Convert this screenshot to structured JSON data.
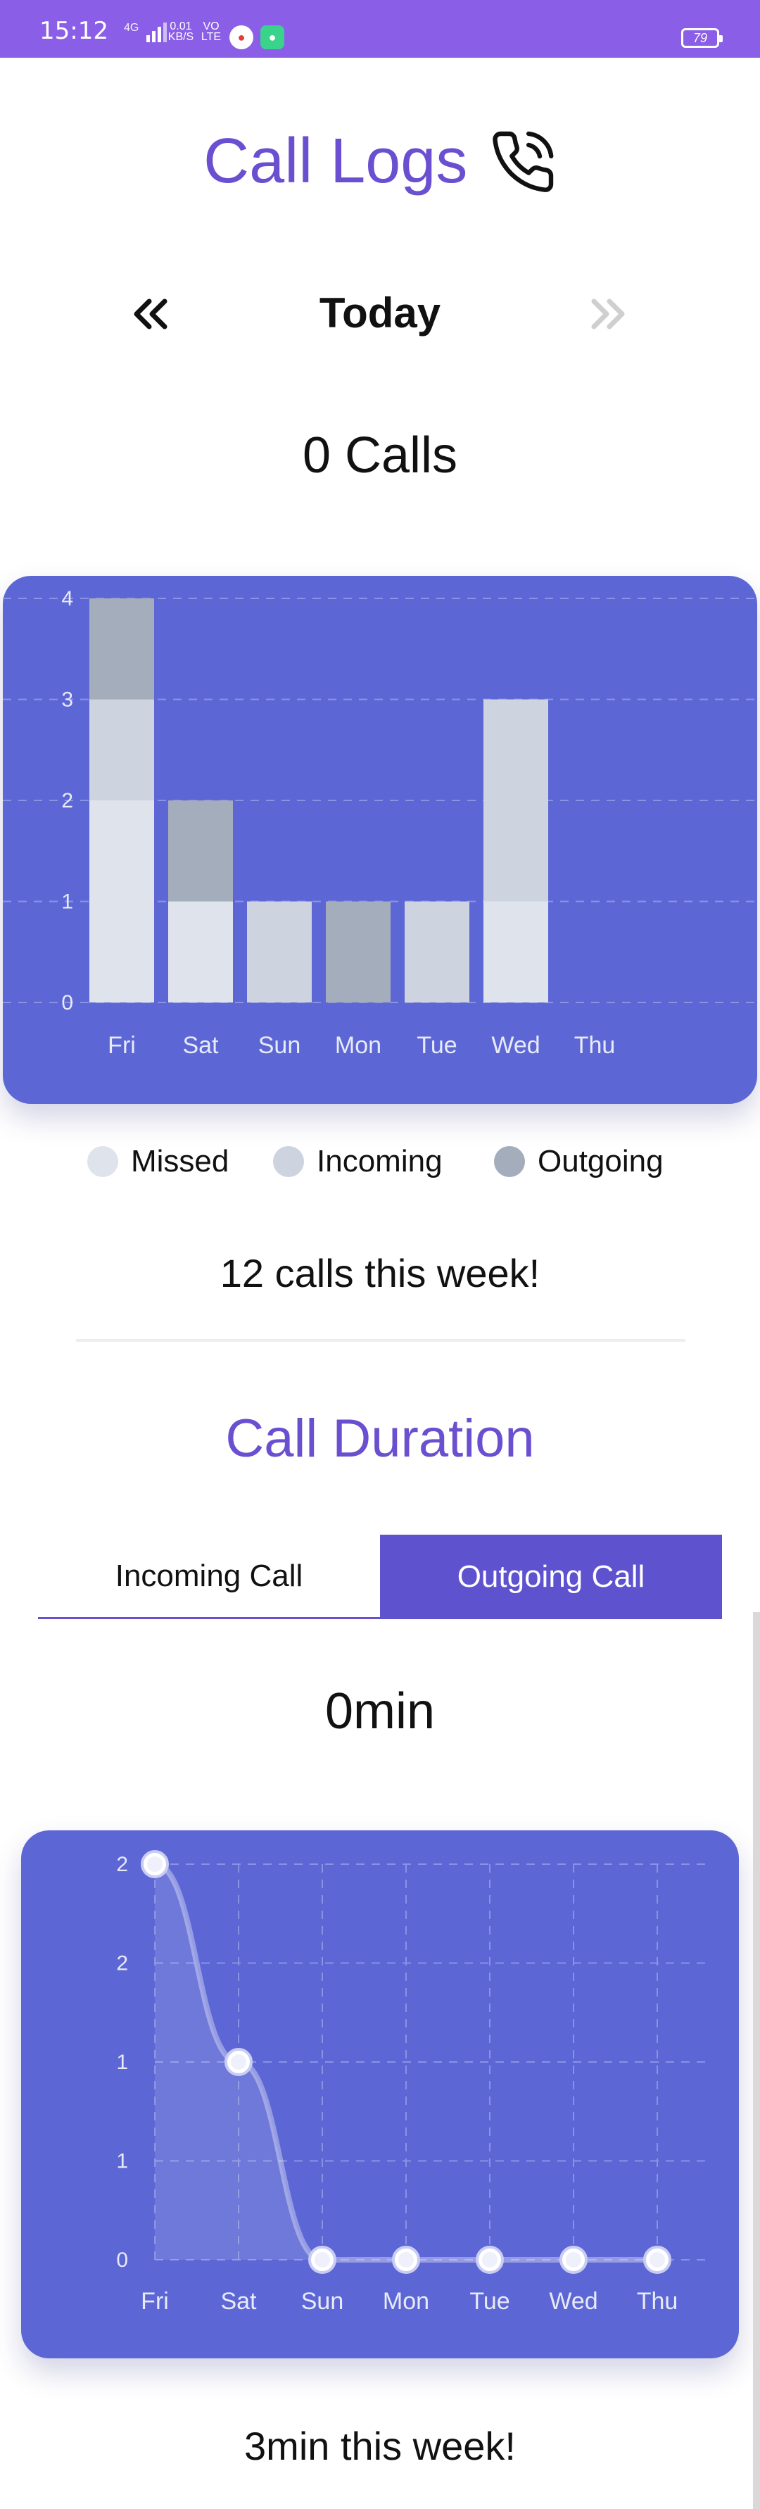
{
  "status_bar": {
    "time": "15:12",
    "network": "4G",
    "speed": "0.01\nKB/S",
    "volte": "VO\nLTE",
    "battery": "79"
  },
  "header": {
    "title": "Call Logs",
    "icon": "phone-call-icon",
    "accent": "#6a4fd0"
  },
  "date_nav": {
    "label": "Today",
    "prev_icon": "double-chevron-left-icon",
    "next_icon": "double-chevron-right-icon"
  },
  "calls_total": "0 Calls",
  "legend": {
    "items": [
      {
        "label": "Missed",
        "color": "#dfe3ec"
      },
      {
        "label": "Incoming",
        "color": "#cdd3df"
      },
      {
        "label": "Outgoing",
        "color": "#a4adbb"
      }
    ]
  },
  "week_summary": "12 calls this week!",
  "duration_section": {
    "title": "Call Duration",
    "tabs": [
      {
        "label": "Incoming Call",
        "active": false
      },
      {
        "label": "Outgoing Call",
        "active": true
      }
    ],
    "total": "0min",
    "summary": "3min this week!"
  },
  "chart_data": [
    {
      "type": "bar",
      "stacked": true,
      "categories": [
        "Fri",
        "Sat",
        "Sun",
        "Mon",
        "Tue",
        "Wed",
        "Thu"
      ],
      "series": [
        {
          "name": "Missed",
          "color": "#dfe3ec",
          "values": [
            2,
            1,
            0,
            0,
            0,
            1,
            0
          ]
        },
        {
          "name": "Incoming",
          "color": "#cdd3df",
          "values": [
            1,
            0,
            1,
            0,
            1,
            2,
            0
          ]
        },
        {
          "name": "Outgoing",
          "color": "#a4adbb",
          "values": [
            1,
            1,
            0,
            1,
            0,
            0,
            0
          ]
        }
      ],
      "ylim": [
        0,
        4
      ],
      "yticks": [
        "0",
        "1",
        "2",
        "3",
        "4"
      ],
      "grid": true,
      "background": "#5c67d5"
    },
    {
      "type": "area",
      "categories": [
        "Fri",
        "Sat",
        "Sun",
        "Mon",
        "Tue",
        "Wed",
        "Thu"
      ],
      "values": [
        2,
        1,
        0,
        0,
        0,
        0,
        0
      ],
      "ylim": [
        0,
        2
      ],
      "yticks": [
        "0",
        "1",
        "1",
        "2",
        "2"
      ],
      "grid": true,
      "background": "#5c67d5"
    }
  ]
}
